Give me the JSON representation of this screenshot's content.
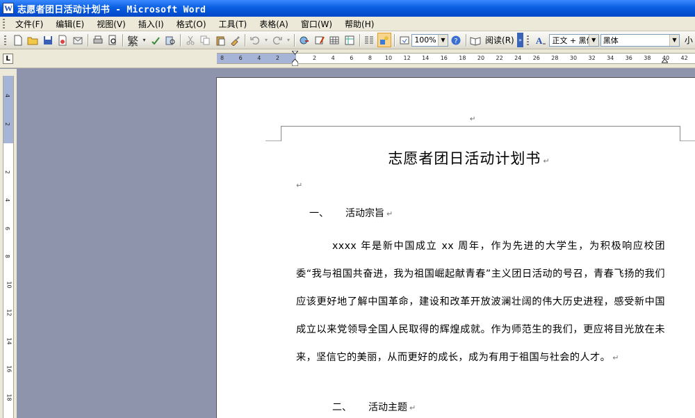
{
  "window": {
    "title": "志愿者团日活动计划书 - Microsoft Word",
    "icon": "word-icon"
  },
  "menu": {
    "items": [
      "文件(F)",
      "编辑(E)",
      "视图(V)",
      "插入(I)",
      "格式(O)",
      "工具(T)",
      "表格(A)",
      "窗口(W)",
      "帮助(H)"
    ]
  },
  "toolbar": {
    "trad_char": "繁",
    "zoom": "100%",
    "read_label": "阅读(R)",
    "style_value": "正文 + 黑体",
    "font_value": "黑体",
    "edge_char": "小"
  },
  "ruler": {
    "tab_selector": "L",
    "left_numbers": [
      "8",
      "6",
      "4",
      "2"
    ],
    "right_numbers": [
      "2",
      "4",
      "6",
      "8",
      "10",
      "12",
      "14",
      "16",
      "18",
      "20",
      "22",
      "24",
      "26",
      "28",
      "30",
      "32",
      "34",
      "36",
      "38",
      "40",
      "42"
    ],
    "vertical_numbers": [
      "4",
      "2",
      "2",
      "4",
      "6",
      "8",
      "10",
      "12",
      "14",
      "16",
      "18",
      "20"
    ]
  },
  "document": {
    "header_mark": "↵",
    "title": "志愿者团日活动计划书",
    "para_mark": "↵",
    "section1_num": "一、",
    "section1_title": "活动宗旨",
    "body": "xxxx 年是新中国成立 xx 周年，作为先进的大学生，为积极响应校团委“我与祖国共奋进，我为祖国崛起献青春”主义团日活动的号召，青春飞扬的我们应该更好地了解中国革命，建设和改革开放波澜壮阔的伟大历史进程，感受新中国成立以来党领导全国人民取得的辉煌成就。作为师范生的我们，更应将目光放在未来，坚信它的美丽，从而更好的成长，成为有用于祖国与社会的人才。",
    "section2_num": "二、",
    "section2_title": "活动主题"
  }
}
